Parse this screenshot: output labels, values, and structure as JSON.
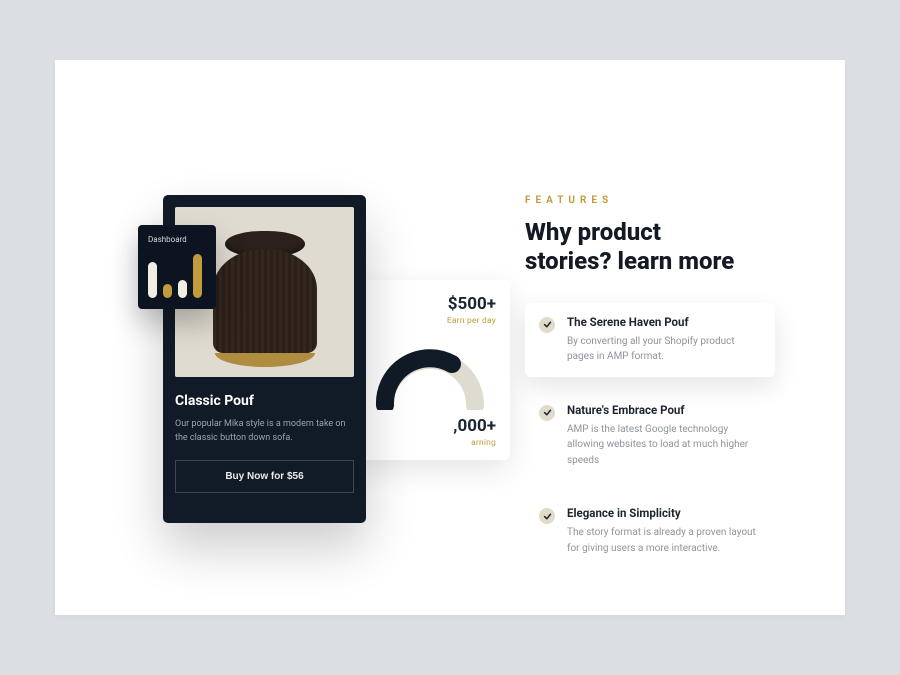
{
  "dashboard_badge": {
    "title": "Dashboard"
  },
  "stats": {
    "value1": "$500+",
    "label1": "Earn per day",
    "value2": ",000+",
    "label2": "arning"
  },
  "product": {
    "title": "Classic Pouf",
    "description": "Our popular Mika style is a modern take on the classic button down sofa.",
    "button": "Buy Now for $56"
  },
  "right": {
    "eyebrow": "FEATURES",
    "headline_line1": "Why product",
    "headline_line2": "stories? learn more",
    "features": [
      {
        "title": "The Serene Haven Pouf",
        "desc": "By converting all your Shopify product pages in AMP format."
      },
      {
        "title": "Nature's Embrace Pouf",
        "desc": "AMP is the latest Google technology allowing websites to load at much higher speeds"
      },
      {
        "title": "Elegance in Simplicity",
        "desc": "The story format is already a proven layout for giving users a more interactive."
      }
    ]
  }
}
